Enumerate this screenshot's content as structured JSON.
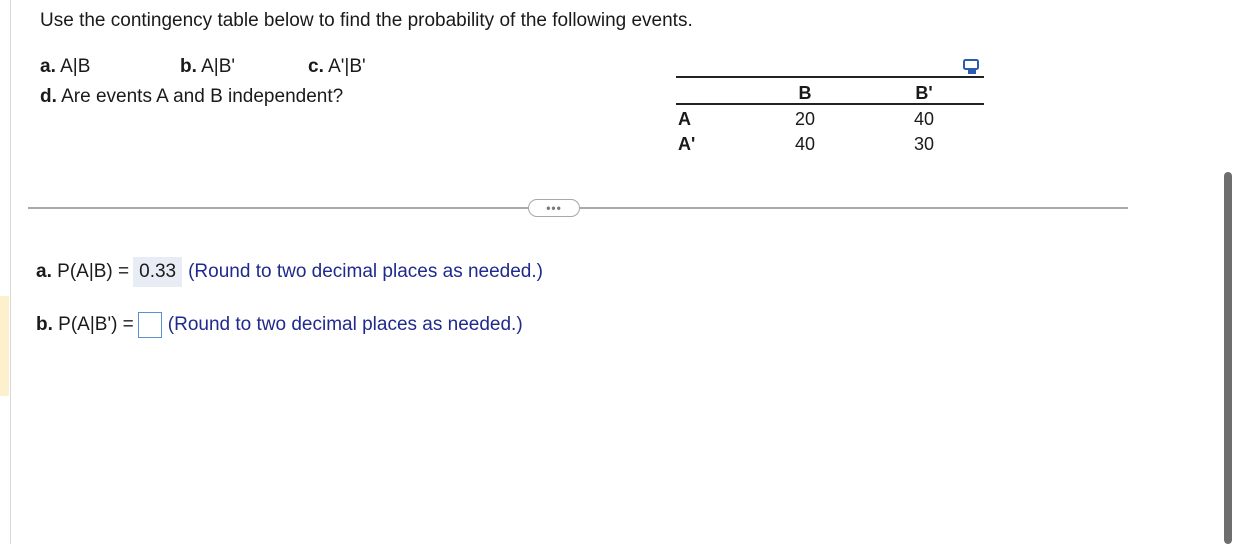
{
  "instructions": "Use the contingency table below to find the probability of the following events.",
  "parts": {
    "a": {
      "prefix": "a.",
      "text": "A|B"
    },
    "b": {
      "prefix": "b.",
      "text": "A|B'"
    },
    "c": {
      "prefix": "c.",
      "text": "A'|B'"
    },
    "d": {
      "prefix": "d.",
      "text": "Are events A and B independent?"
    }
  },
  "table": {
    "col_headers": [
      "B",
      "B'"
    ],
    "rows": [
      {
        "label": "A",
        "values": [
          "20",
          "40"
        ]
      },
      {
        "label": "A'",
        "values": [
          "40",
          "30"
        ]
      }
    ]
  },
  "icons": {
    "copy": "copy-icon",
    "more": "ellipsis-icon"
  },
  "more_button_label": "•••",
  "answers": {
    "a": {
      "prefix": "a.",
      "label": "P(A|B) =",
      "value": "0.33",
      "hint": "(Round to two decimal places as needed.)"
    },
    "b": {
      "prefix": "b.",
      "label": "P(A|B') =",
      "value": "",
      "hint": "(Round to two decimal places as needed.)"
    }
  },
  "colors": {
    "hint": "#1f2a8c",
    "answer_bg": "#e8edf5",
    "input_border": "#5a8fd0",
    "accent": "#fdf0cc"
  }
}
